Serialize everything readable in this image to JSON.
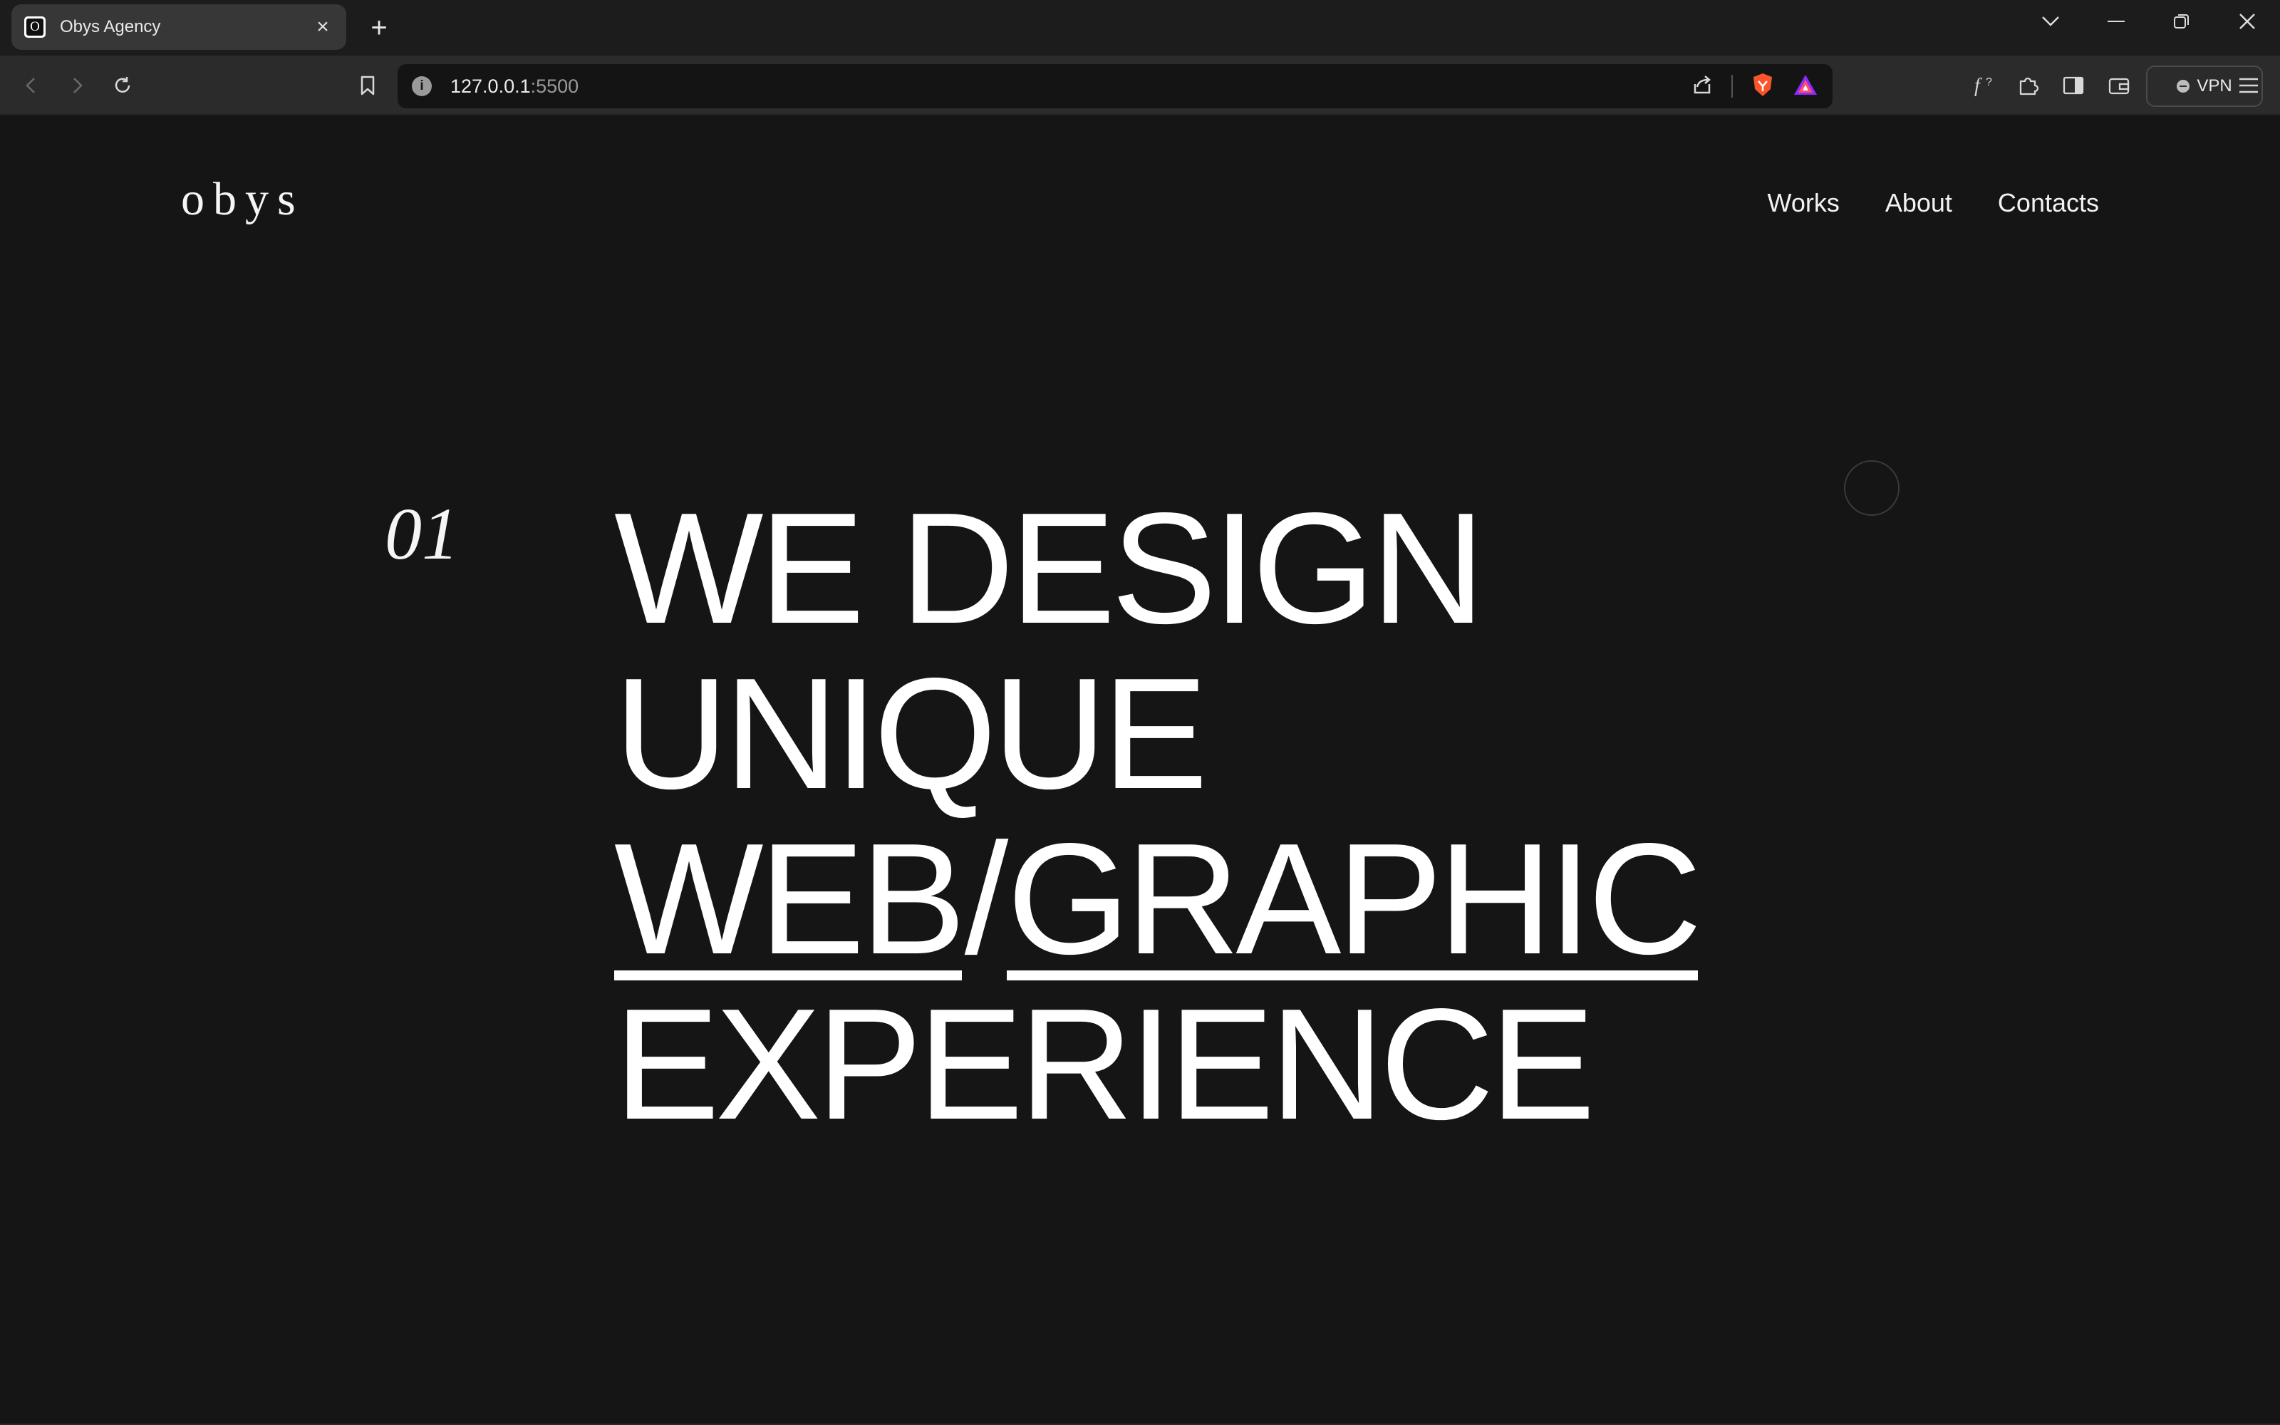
{
  "browser": {
    "tab": {
      "favicon_letter": "O",
      "title": "Obys Agency",
      "close_glyph": "×"
    },
    "new_tab_glyph": "+",
    "url": {
      "host": "127.0.0.1",
      "port": ":5500"
    },
    "vpn_label": "VPN"
  },
  "site": {
    "logo": "obys",
    "nav": {
      "works": "Works",
      "about": "About",
      "contacts": "Contacts"
    },
    "hero": {
      "number": "01",
      "line1": "WE DESIGN",
      "line2": "UNIQUE",
      "line3_part1": "WEB",
      "line3_slash": "/",
      "line3_part2": "GRAPHIC",
      "line4": "EXPERIENCE"
    }
  },
  "colors": {
    "page_background": "#151515",
    "text": "#ffffff",
    "tab_active": "#373737",
    "toolbar": "#2b2b2b",
    "brave_orange": "#fb542b"
  }
}
